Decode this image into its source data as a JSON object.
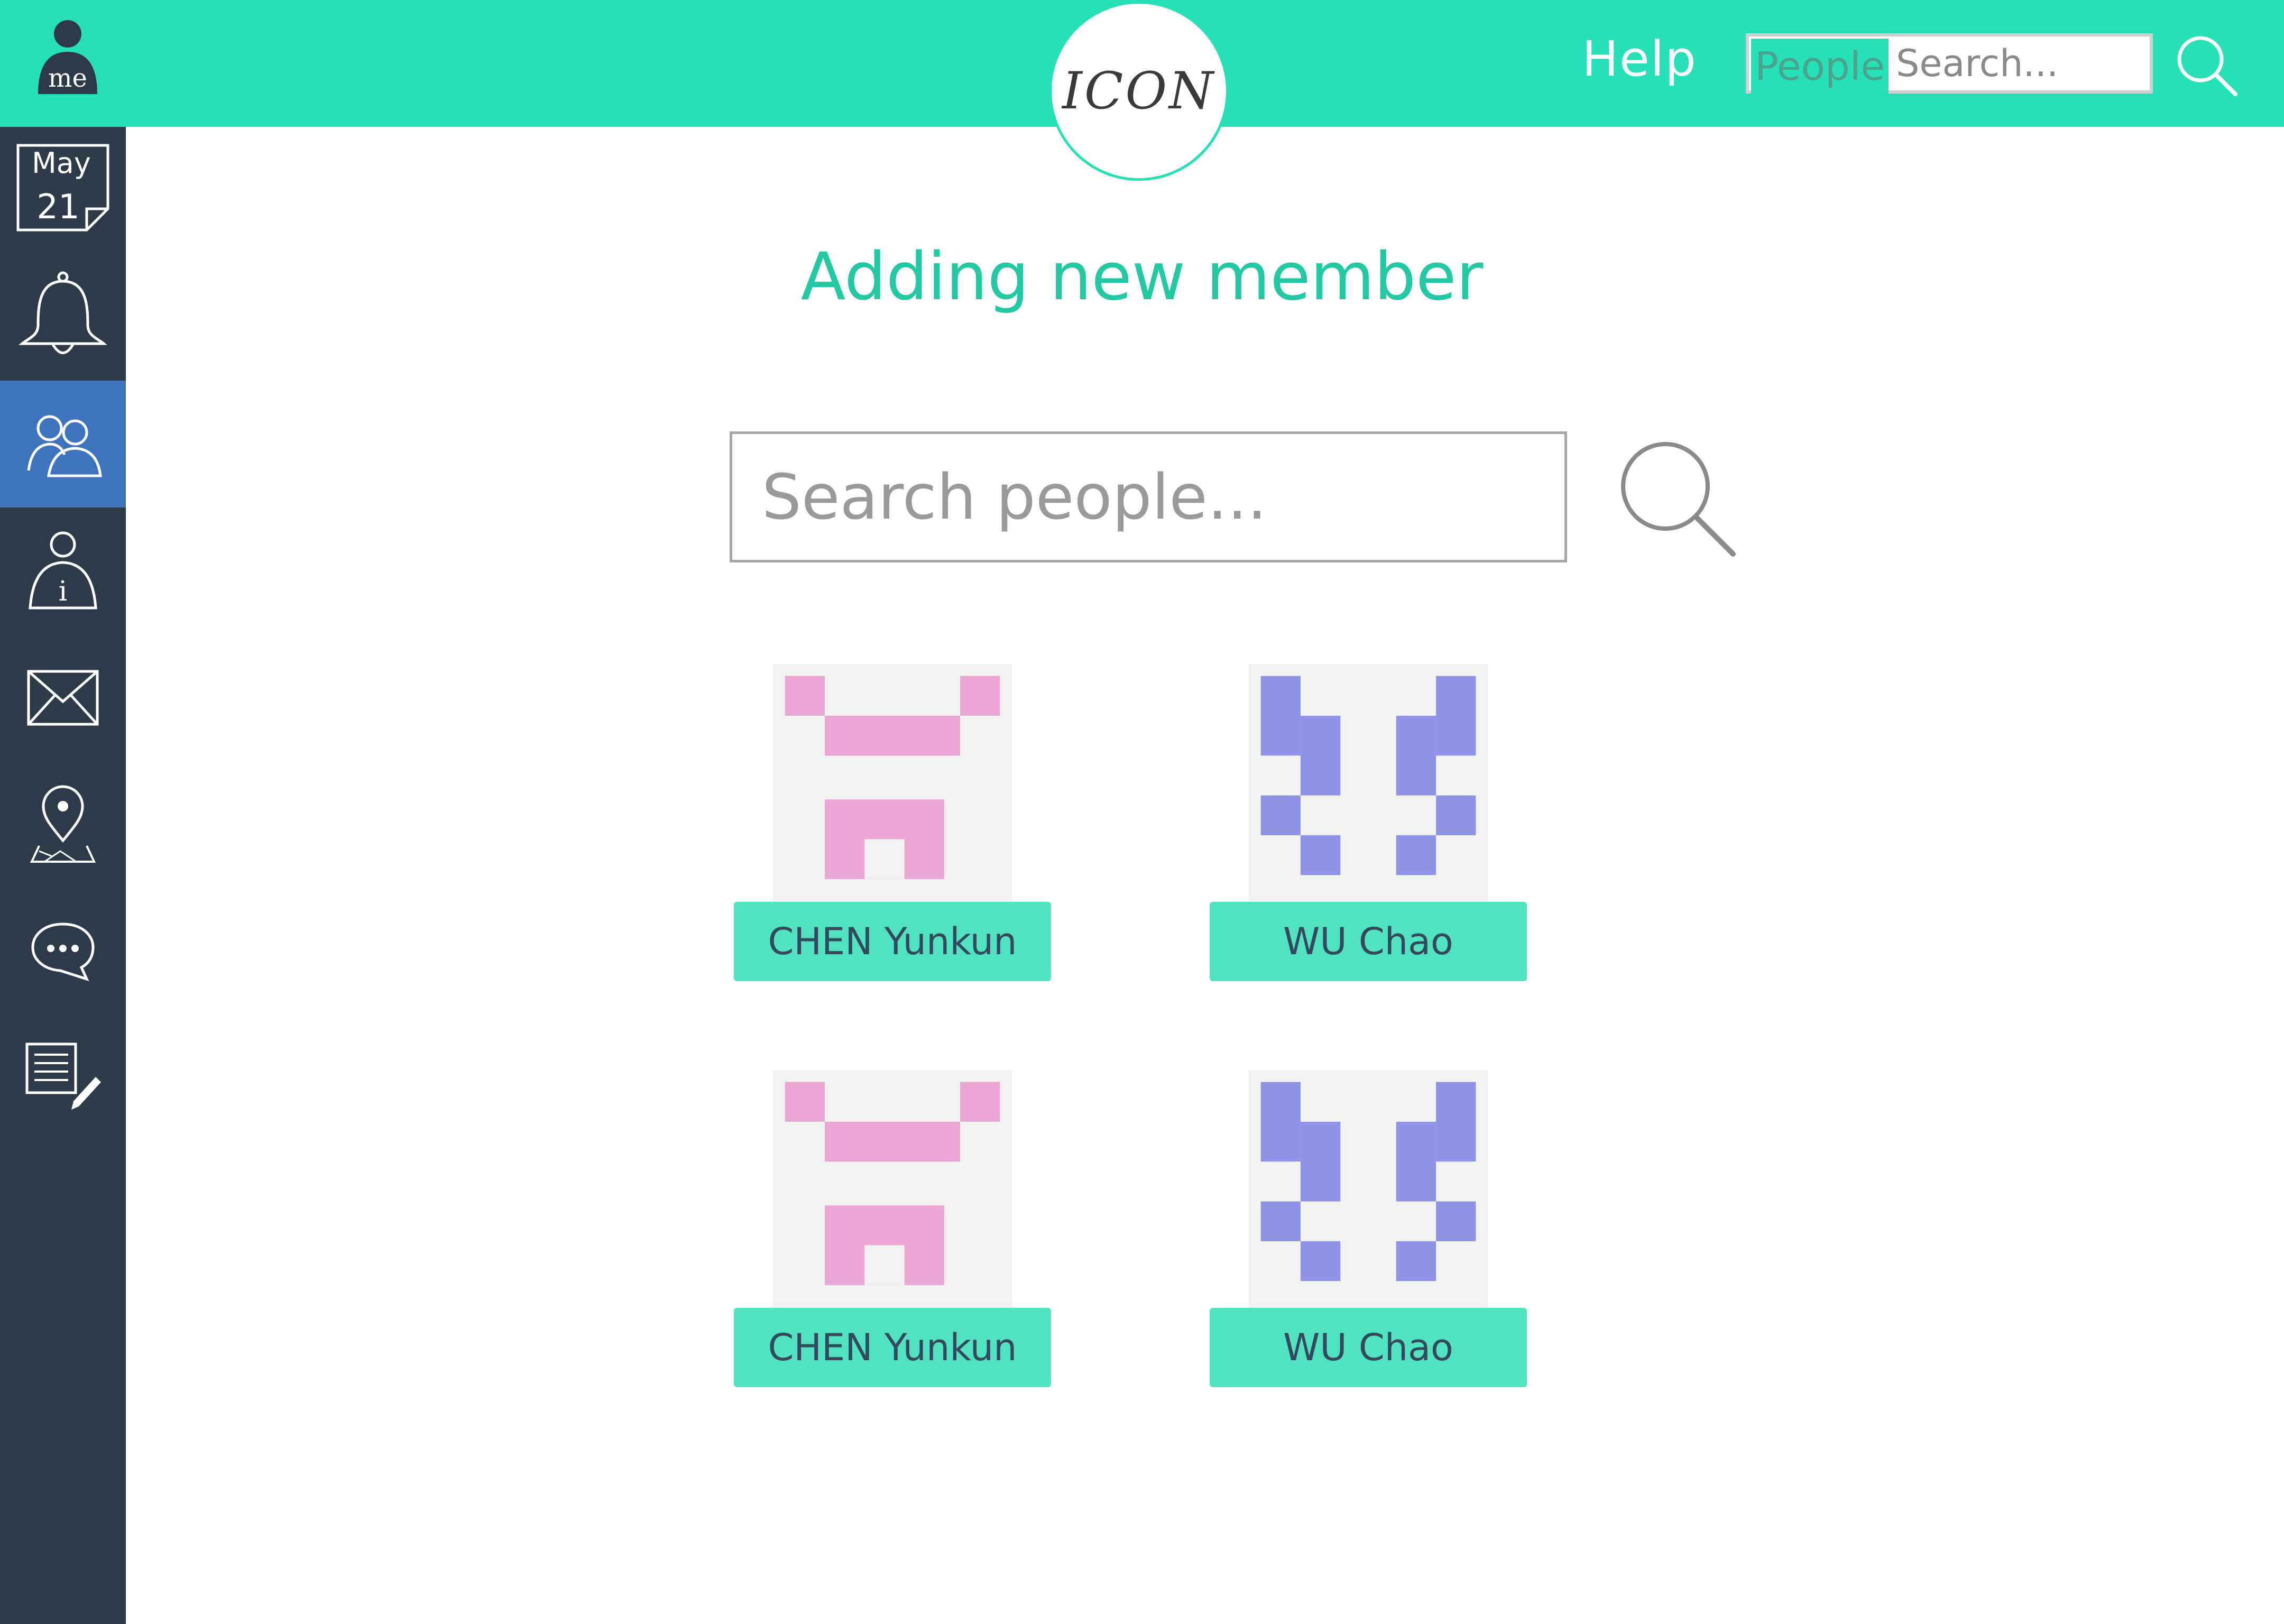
{
  "header": {
    "avatar_label": "me",
    "logo": "ICON",
    "help_label": "Help",
    "search": {
      "scope": "People",
      "placeholder": "Search..."
    },
    "search_icon": "search-icon",
    "background_color": "#27e1b6"
  },
  "sidebar": {
    "background_color": "#2e3a48",
    "active_color": "#3e74be",
    "calendar": {
      "month": "May",
      "day": "21"
    },
    "items": [
      {
        "icon": "calendar-icon",
        "active": false
      },
      {
        "icon": "bell-icon",
        "active": false
      },
      {
        "icon": "people-icon",
        "active": true
      },
      {
        "icon": "person-info-icon",
        "active": false
      },
      {
        "icon": "mail-icon",
        "active": false
      },
      {
        "icon": "map-pin-icon",
        "active": false
      },
      {
        "icon": "chat-icon",
        "active": false
      },
      {
        "icon": "notes-edit-icon",
        "active": false
      }
    ]
  },
  "main": {
    "title": "Adding new member",
    "search": {
      "placeholder": "Search people..."
    },
    "search_icon": "search-icon",
    "members": [
      {
        "name": "CHEN Yunkun",
        "avatar_color": "#eba7d4",
        "avatar_pattern": "pink"
      },
      {
        "name": "WU Chao",
        "avatar_color": "#9193e6",
        "avatar_pattern": "purple"
      },
      {
        "name": "CHEN Yunkun",
        "avatar_color": "#eba7d4",
        "avatar_pattern": "pink"
      },
      {
        "name": "WU Chao",
        "avatar_color": "#9193e6",
        "avatar_pattern": "purple"
      }
    ],
    "accent_color": "#51e3c0"
  }
}
